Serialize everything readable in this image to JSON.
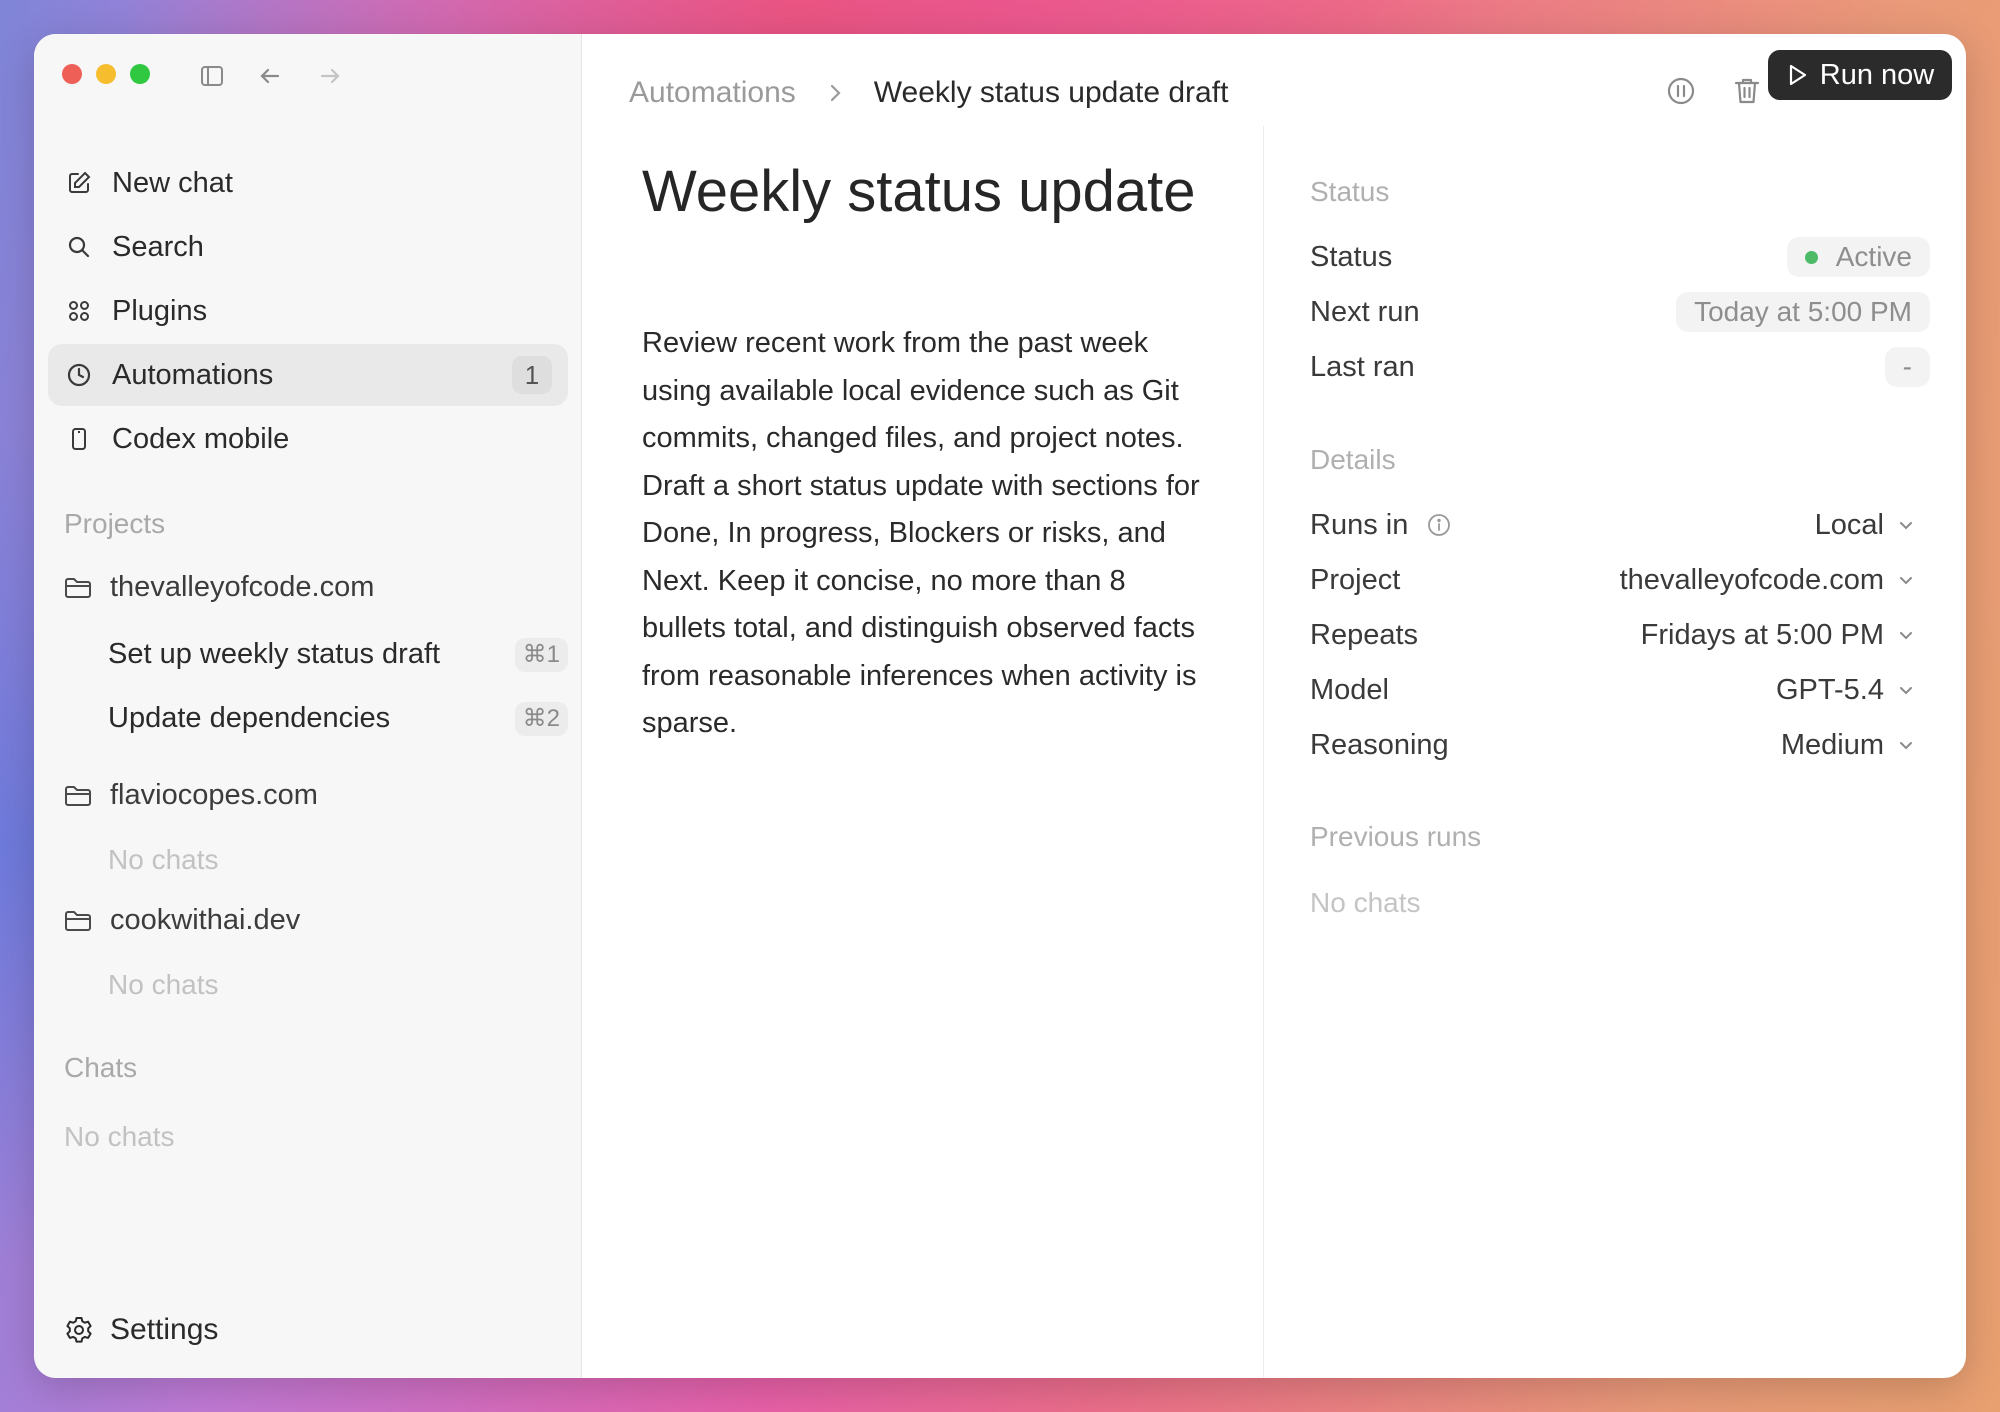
{
  "sidebar": {
    "nav": [
      {
        "label": "New chat",
        "icon": "compose-icon"
      },
      {
        "label": "Search",
        "icon": "search-icon"
      },
      {
        "label": "Plugins",
        "icon": "grid-icon"
      },
      {
        "label": "Automations",
        "icon": "clock-icon",
        "badge": "1",
        "active": true
      },
      {
        "label": "Codex mobile",
        "icon": "phone-icon"
      }
    ],
    "projects_label": "Projects",
    "projects": [
      {
        "name": "thevalleyofcode.com",
        "chats": [
          {
            "label": "Set up weekly status draft",
            "shortcut": "⌘1"
          },
          {
            "label": "Update dependencies",
            "shortcut": "⌘2"
          }
        ]
      },
      {
        "name": "flaviocopes.com",
        "empty": "No chats"
      },
      {
        "name": "cookwithai.dev",
        "empty": "No chats"
      }
    ],
    "chats_label": "Chats",
    "chats_empty": "No chats",
    "settings_label": "Settings"
  },
  "header": {
    "breadcrumb_root": "Automations",
    "breadcrumb_current": "Weekly status update draft",
    "run_label": "Run now"
  },
  "main": {
    "title": "Weekly status update draft",
    "body": "Review recent work from the past week using available local evidence such as Git commits, changed files, and project notes. Draft a short status update with sections for Done, In progress, Blockers or risks, and Next. Keep it concise, no more than 8 bullets total, and distinguish observed facts from reasonable inferences when activity is sparse."
  },
  "panel": {
    "status_section": "Status",
    "status_label": "Status",
    "status_value": "Active",
    "next_run_label": "Next run",
    "next_run_value": "Today at 5:00 PM",
    "last_ran_label": "Last ran",
    "last_ran_value": "-",
    "details_section": "Details",
    "runs_in_label": "Runs in",
    "runs_in_value": "Local",
    "project_label": "Project",
    "project_value": "thevalleyofcode.com",
    "repeats_label": "Repeats",
    "repeats_value": "Fridays at 5:00 PM",
    "model_label": "Model",
    "model_value": "GPT-5.4",
    "reasoning_label": "Reasoning",
    "reasoning_value": "Medium",
    "previous_runs_section": "Previous runs",
    "previous_runs_empty": "No chats"
  },
  "colors": {
    "status_active": "#4cba67",
    "run_button_bg": "#2b2b2b"
  }
}
